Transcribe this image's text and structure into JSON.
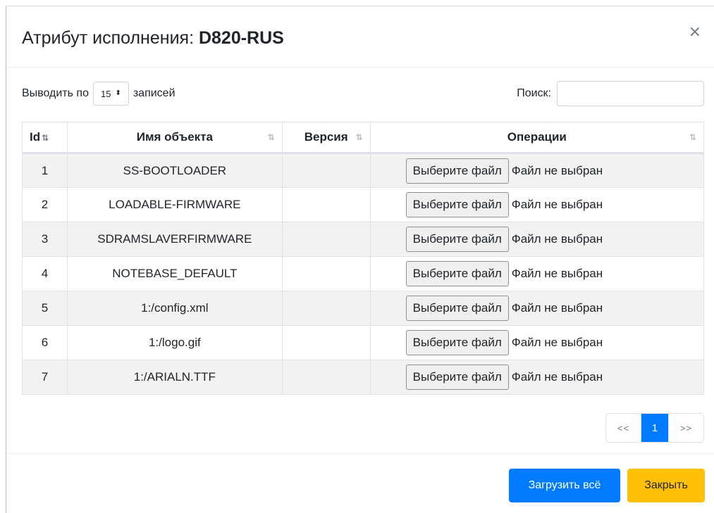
{
  "modal": {
    "title_prefix": "Атрибут исполнения: ",
    "title_device": "D820-RUS",
    "close_symbol": "×"
  },
  "length": {
    "prefix": "Выводить по",
    "value": "15",
    "arrows": "⬍",
    "suffix": "записей"
  },
  "search": {
    "label": "Поиск:",
    "value": ""
  },
  "table": {
    "headers": {
      "id": "Id",
      "name": "Имя объекта",
      "version": "Версия",
      "ops": "Операции"
    },
    "sort_icon": "⇅",
    "rows": [
      {
        "id": "1",
        "name": "SS-BOOTLOADER",
        "version": ""
      },
      {
        "id": "2",
        "name": "LOADABLE-FIRMWARE",
        "version": ""
      },
      {
        "id": "3",
        "name": "SDRAMSLAVERFIRMWARE",
        "version": ""
      },
      {
        "id": "4",
        "name": "NOTEBASE_DEFAULT",
        "version": ""
      },
      {
        "id": "5",
        "name": "1:/config.xml",
        "version": ""
      },
      {
        "id": "6",
        "name": "1:/logo.gif",
        "version": ""
      },
      {
        "id": "7",
        "name": "1:/ARIALN.TTF",
        "version": ""
      }
    ],
    "file_button_label": "Выберите файл",
    "file_status": "Файл не выбран"
  },
  "pagination": {
    "prev": "<<",
    "current": "1",
    "next": ">>"
  },
  "footer": {
    "load_all": "Загрузить всё",
    "close": "Закрыть"
  },
  "colors": {
    "primary": "#007bff",
    "warning": "#ffc107",
    "stripe": "#f2f2f2"
  }
}
